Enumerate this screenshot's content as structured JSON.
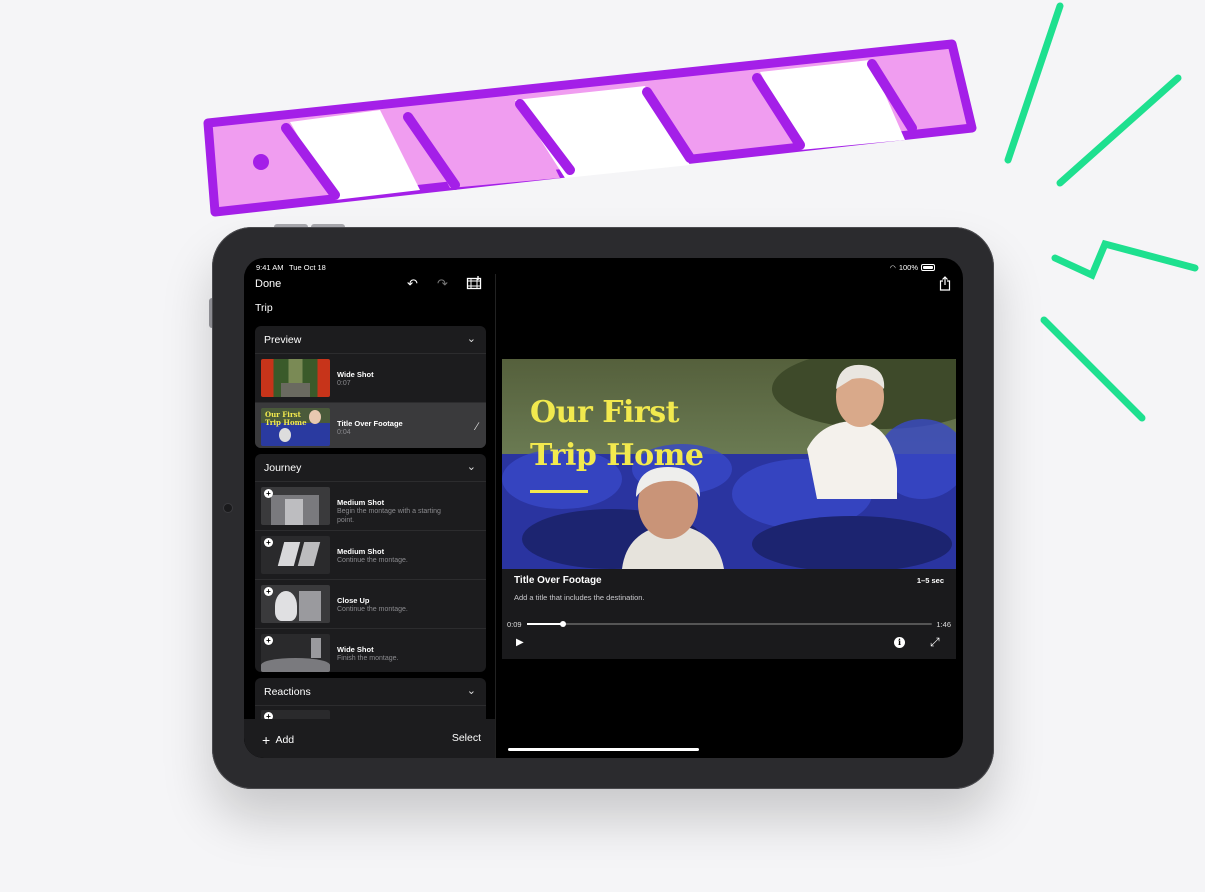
{
  "colors": {
    "accent_title": "#f2e94e",
    "clapper_fill": "#f09df0",
    "clapper_stroke": "#a41fe8",
    "burst": "#1ee08f"
  },
  "status_bar": {
    "time": "9:41 AM",
    "date": "Tue Oct 18",
    "battery": "100%"
  },
  "toolbar": {
    "done_label": "Done",
    "undo_icon": "undo-icon",
    "redo_icon": "redo-icon",
    "storyboard_icon": "film-icon",
    "share_icon": "share-icon"
  },
  "project": {
    "title": "Trip"
  },
  "sections": [
    {
      "title": "Preview",
      "items": [
        {
          "title": "Wide Shot",
          "subtitle": "0:07"
        },
        {
          "title": "Title Over Footage",
          "subtitle": "0:04",
          "selected": true
        }
      ]
    },
    {
      "title": "Journey",
      "items": [
        {
          "title": "Medium Shot",
          "subtitle": "Begin the montage with a starting point."
        },
        {
          "title": "Medium Shot",
          "subtitle": "Continue the montage."
        },
        {
          "title": "Close Up",
          "subtitle": "Continue the montage."
        },
        {
          "title": "Wide Shot",
          "subtitle": "Finish the montage."
        }
      ]
    },
    {
      "title": "Reactions",
      "items": []
    }
  ],
  "bottom_bar": {
    "add_label": "Add",
    "select_label": "Select"
  },
  "video": {
    "title_line1": "Our First",
    "title_line2": "Trip Home"
  },
  "clip_info": {
    "title": "Title Over Footage",
    "duration": "1–5 sec",
    "description": "Add a title that includes the destination."
  },
  "playback": {
    "current": "0:09",
    "total": "1:46",
    "progress_fraction": 0.09
  }
}
